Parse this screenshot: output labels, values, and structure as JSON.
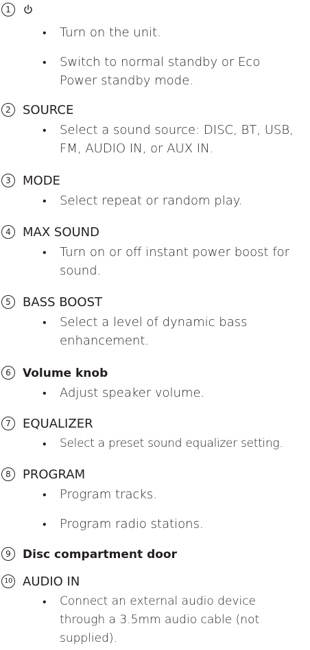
{
  "items": [
    {
      "num": "1",
      "title": "",
      "bullets": [
        "Turn on the unit.",
        "Switch to normal standby or Eco Power standby mode."
      ]
    },
    {
      "num": "2",
      "title": "SOURCE",
      "bullets": [
        "Select a sound source: DISC, BT, USB, FM, AUDIO IN, or AUX IN."
      ]
    },
    {
      "num": "3",
      "title": "MODE",
      "bullets": [
        "Select repeat or random play."
      ]
    },
    {
      "num": "4",
      "title": "MAX SOUND",
      "bullets": [
        "Turn on or off instant power boost for sound."
      ]
    },
    {
      "num": "5",
      "title": "BASS BOOST",
      "bullets": [
        "Select a level of dynamic bass enhancement."
      ]
    },
    {
      "num": "6",
      "title": "Volume knob",
      "bullets": [
        "Adjust speaker volume."
      ]
    },
    {
      "num": "7",
      "title": "EQUALIZER",
      "bullets": [
        "Select a preset sound equalizer setting."
      ]
    },
    {
      "num": "8",
      "title": "PROGRAM",
      "bullets": [
        "Program tracks.",
        "Program radio stations."
      ]
    },
    {
      "num": "9",
      "title": "Disc compartment door",
      "bullets": []
    },
    {
      "num": "10",
      "title": "AUDIO IN",
      "bullets": [
        "Connect an external audio device through a 3.5mm audio cable (not supplied)."
      ]
    }
  ],
  "icons": {
    "item1": "power-icon"
  }
}
